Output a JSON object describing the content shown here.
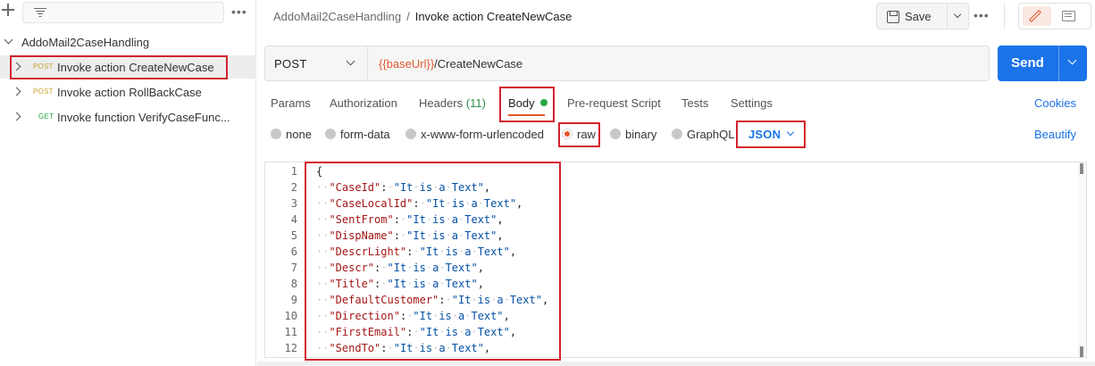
{
  "sidebar": {
    "collection_name": "AddoMail2CaseHandling",
    "items": [
      {
        "method": "POST",
        "label": "Invoke action CreateNewCase"
      },
      {
        "method": "POST",
        "label": "Invoke action RollBackCase"
      },
      {
        "method": "GET",
        "label": "Invoke function VerifyCaseFunc..."
      }
    ],
    "icons": {
      "new": "plus-icon",
      "filter": "filter-icon",
      "more": "more-icon"
    }
  },
  "header": {
    "breadcrumb_parent": "AddoMail2CaseHandling",
    "breadcrumb_separator": "/",
    "breadcrumb_current": "Invoke action CreateNewCase",
    "save_label": "Save"
  },
  "request": {
    "method": "POST",
    "url_variable": "{{baseUrl}}",
    "url_path": "/CreateNewCase",
    "send_label": "Send"
  },
  "tabs": {
    "params": "Params",
    "authorization": "Authorization",
    "headers": "Headers",
    "headers_count": "(11)",
    "body": "Body",
    "prerequest": "Pre-request Script",
    "tests": "Tests",
    "settings": "Settings",
    "cookies": "Cookies",
    "active": "Body"
  },
  "body_types": {
    "none": "none",
    "form_data": "form-data",
    "urlencoded": "x-www-form-urlencoded",
    "raw": "raw",
    "binary": "binary",
    "graphql": "GraphQL",
    "selected": "raw",
    "format": "JSON",
    "beautify": "Beautify"
  },
  "editor": {
    "lines": [
      {
        "no": "1",
        "text": "{"
      },
      {
        "no": "2",
        "key": "\"CaseId\"",
        "value": "\"It is a Text\""
      },
      {
        "no": "3",
        "key": "\"CaseLocalId\"",
        "value": "\"It is a Text\""
      },
      {
        "no": "4",
        "key": "\"SentFrom\"",
        "value": "\"It is a Text\""
      },
      {
        "no": "5",
        "key": "\"DispName\"",
        "value": "\"It is a Text\""
      },
      {
        "no": "6",
        "key": "\"DescrLight\"",
        "value": "\"It is a Text\""
      },
      {
        "no": "7",
        "key": "\"Descr\"",
        "value": "\"It is a Text\""
      },
      {
        "no": "8",
        "key": "\"Title\"",
        "value": "\"It is a Text\""
      },
      {
        "no": "9",
        "key": "\"DefaultCustomer\"",
        "value": "\"It is a Text\""
      },
      {
        "no": "10",
        "key": "\"Direction\"",
        "value": "\"It is a Text\""
      },
      {
        "no": "11",
        "key": "\"FirstEmail\"",
        "value": "\"It is a Text\""
      },
      {
        "no": "12",
        "key": "\"SendTo\"",
        "value": "\"It is a Text\""
      }
    ]
  },
  "colors": {
    "accent_orange": "#e4572e",
    "send_blue": "#1a73e8",
    "highlight_red": "#d3212f",
    "post_method": "#c9a22b",
    "get_method": "#28a745",
    "json_key": "#a31515",
    "json_string": "#0451a5"
  }
}
